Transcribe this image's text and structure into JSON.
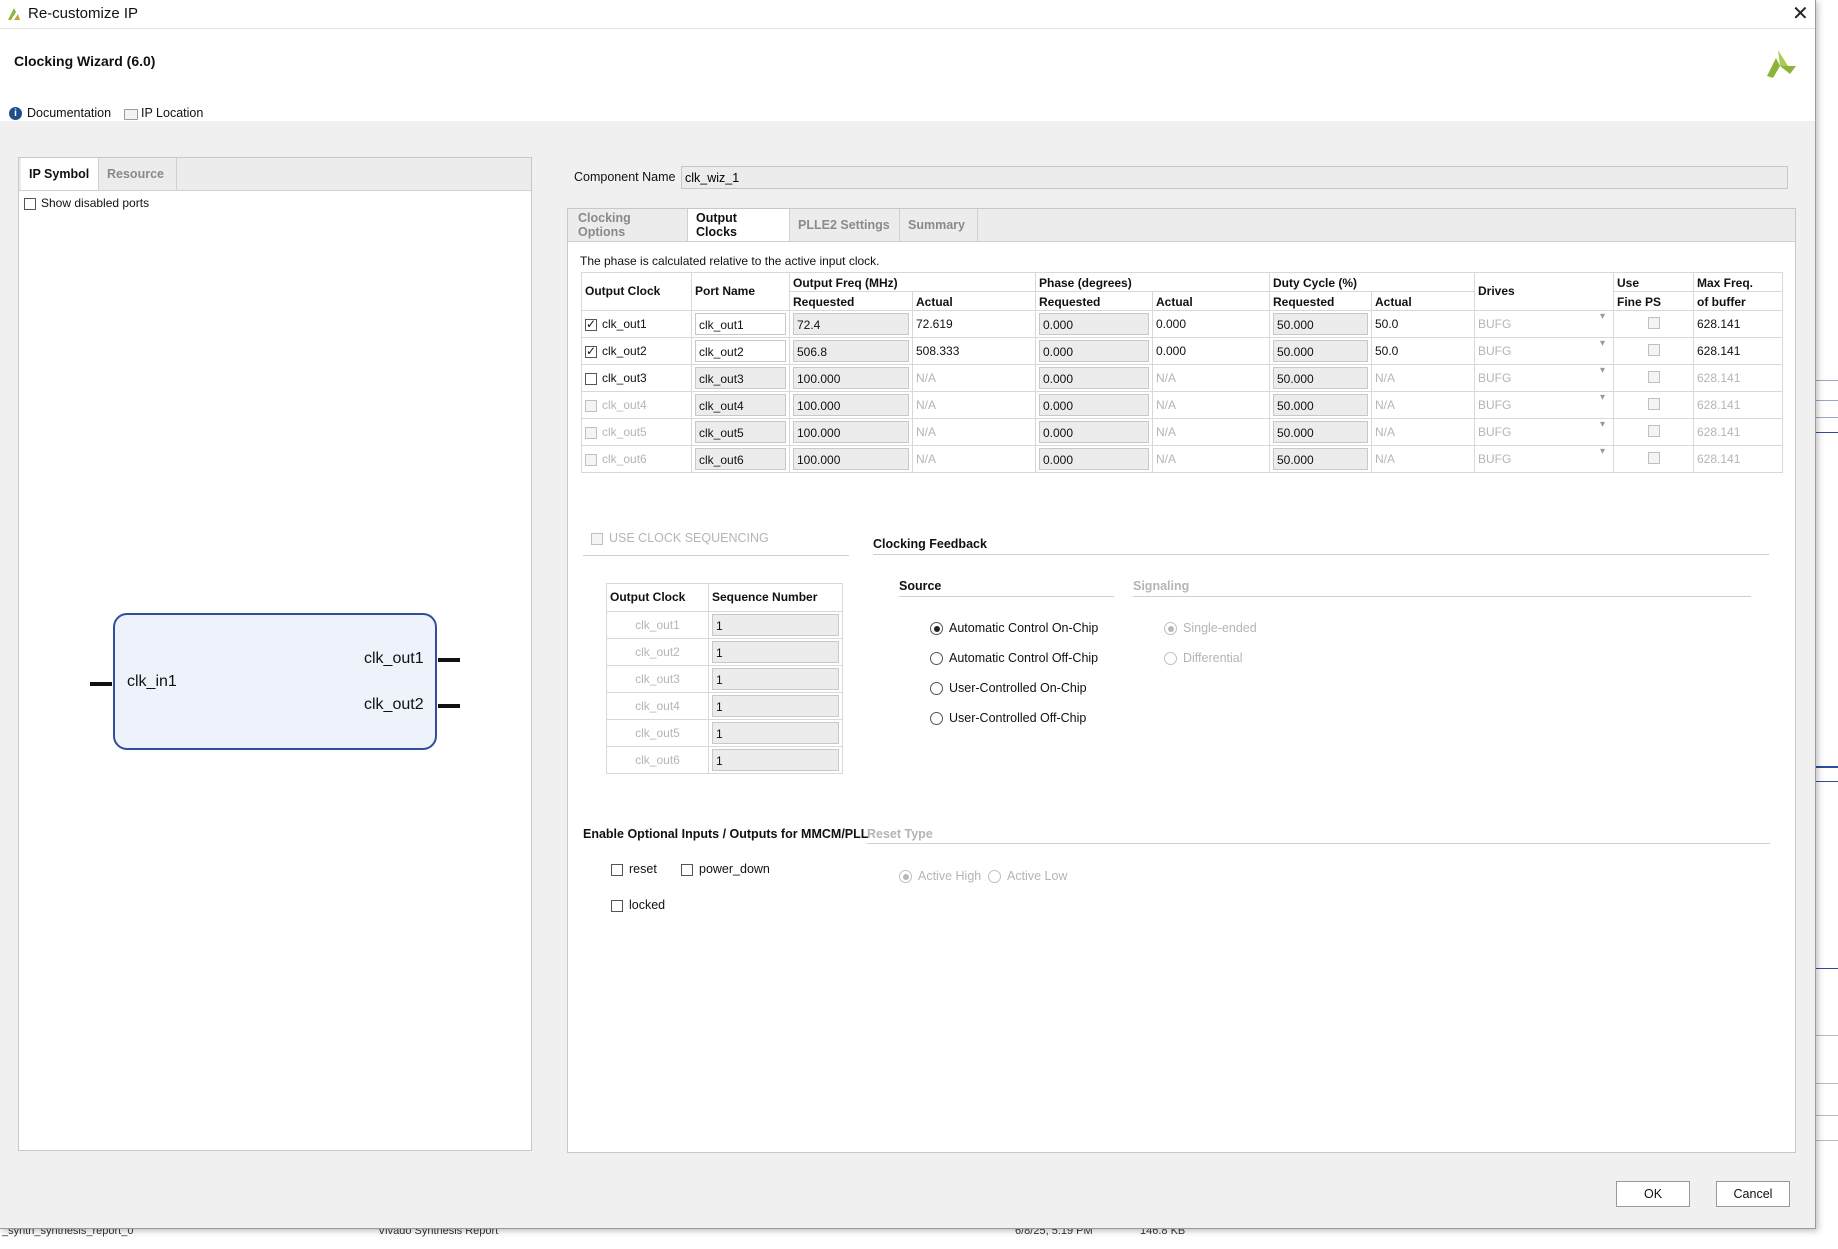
{
  "dialog": {
    "title": "Re-customize IP",
    "heading": "Clocking Wizard (6.0)"
  },
  "links": {
    "documentation": "Documentation",
    "ip_location": "IP Location"
  },
  "left_tabs": [
    "IP Symbol",
    "Resource"
  ],
  "show_disabled_ports": "Show disabled ports",
  "symbol": {
    "input": "clk_in1",
    "outputs": [
      "clk_out1",
      "clk_out2"
    ]
  },
  "component": {
    "label": "Component Name",
    "value": "clk_wiz_1"
  },
  "main_tabs": [
    "Clocking Options",
    "Output Clocks",
    "PLLE2 Settings",
    "Summary"
  ],
  "phase_note": "The phase is calculated relative to the active input clock.",
  "table": {
    "headers": {
      "output_clock": "Output Clock",
      "port_name": "Port Name",
      "output_freq": "Output Freq (MHz)",
      "phase": "Phase (degrees)",
      "duty": "Duty Cycle (%)",
      "requested": "Requested",
      "actual": "Actual",
      "drives": "Drives",
      "use": "Use",
      "fine_ps": "Fine PS",
      "max_freq": "Max Freq.",
      "of_buffer": "of buffer"
    },
    "rows": [
      {
        "clock": "clk_out1",
        "port": "clk_out1",
        "freq_req": "72.4",
        "freq_act": "72.619",
        "phase_req": "0.000",
        "phase_act": "0.000",
        "duty_req": "50.000",
        "duty_act": "50.0",
        "drives": "BUFG",
        "max": "628.141"
      },
      {
        "clock": "clk_out2",
        "port": "clk_out2",
        "freq_req": "506.8",
        "freq_act": "508.333",
        "phase_req": "0.000",
        "phase_act": "0.000",
        "duty_req": "50.000",
        "duty_act": "50.0",
        "drives": "BUFG",
        "max": "628.141"
      },
      {
        "clock": "clk_out3",
        "port": "clk_out3",
        "freq_req": "100.000",
        "freq_act": "N/A",
        "phase_req": "0.000",
        "phase_act": "N/A",
        "duty_req": "50.000",
        "duty_act": "N/A",
        "drives": "BUFG",
        "max": "628.141"
      },
      {
        "clock": "clk_out4",
        "port": "clk_out4",
        "freq_req": "100.000",
        "freq_act": "N/A",
        "phase_req": "0.000",
        "phase_act": "N/A",
        "duty_req": "50.000",
        "duty_act": "N/A",
        "drives": "BUFG",
        "max": "628.141"
      },
      {
        "clock": "clk_out5",
        "port": "clk_out5",
        "freq_req": "100.000",
        "freq_act": "N/A",
        "phase_req": "0.000",
        "phase_act": "N/A",
        "duty_req": "50.000",
        "duty_act": "N/A",
        "drives": "BUFG",
        "max": "628.141"
      },
      {
        "clock": "clk_out6",
        "port": "clk_out6",
        "freq_req": "100.000",
        "freq_act": "N/A",
        "phase_req": "0.000",
        "phase_act": "N/A",
        "duty_req": "50.000",
        "duty_act": "N/A",
        "drives": "BUFG",
        "max": "628.141"
      }
    ]
  },
  "sequencing": {
    "label": "USE CLOCK SEQUENCING",
    "col_clock": "Output Clock",
    "col_seq": "Sequence Number",
    "rows": [
      {
        "clock": "clk_out1",
        "seq": "1"
      },
      {
        "clock": "clk_out2",
        "seq": "1"
      },
      {
        "clock": "clk_out3",
        "seq": "1"
      },
      {
        "clock": "clk_out4",
        "seq": "1"
      },
      {
        "clock": "clk_out5",
        "seq": "1"
      },
      {
        "clock": "clk_out6",
        "seq": "1"
      }
    ]
  },
  "feedback": {
    "title": "Clocking Feedback",
    "source": "Source",
    "signaling": "Signaling",
    "sources": [
      "Automatic Control On-Chip",
      "Automatic Control Off-Chip",
      "User-Controlled On-Chip",
      "User-Controlled Off-Chip"
    ],
    "signals": [
      "Single-ended",
      "Differential"
    ]
  },
  "optional": {
    "title": "Enable Optional Inputs / Outputs for MMCM/PLL",
    "reset": "reset",
    "power_down": "power_down",
    "locked": "locked"
  },
  "reset_type": {
    "title": "Reset Type",
    "high": "Active High",
    "low": "Active Low"
  },
  "buttons": {
    "ok": "OK",
    "cancel": "Cancel"
  },
  "background": {
    "row_name": "_synth_synthesis_report_0",
    "row_type": "Vivado Synthesis Report",
    "row_date": "6/8/25, 5:19 PM",
    "row_size": "146.8 KB"
  },
  "colors": {
    "accent_logo": "#8db43a",
    "symbol_fill": "#eef3fb",
    "symbol_border": "#2f4f9a",
    "info_icon": "#1f4e8c"
  }
}
